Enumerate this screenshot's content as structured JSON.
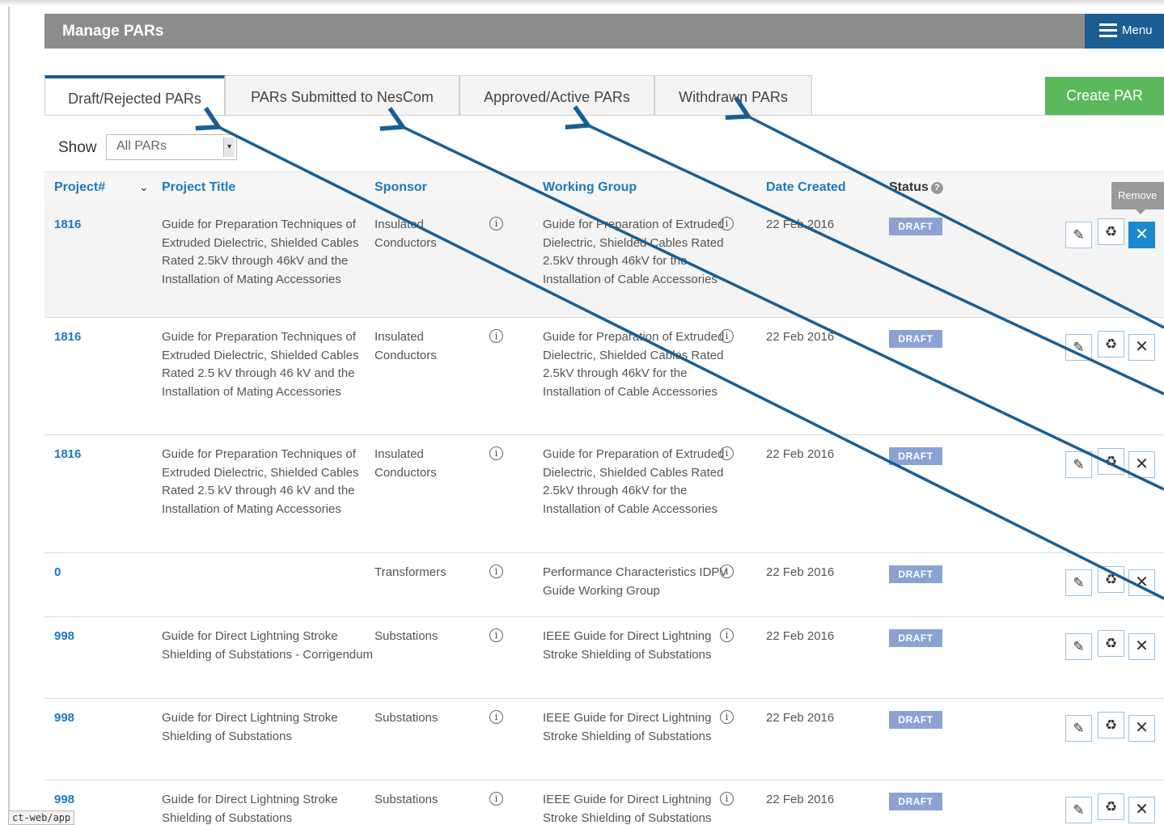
{
  "header": {
    "title": "Manage PARs",
    "menu_label": "Menu"
  },
  "tabs": [
    {
      "label": "Draft/Rejected PARs",
      "active": true
    },
    {
      "label": "PARs Submitted to NesCom",
      "active": false
    },
    {
      "label": "Approved/Active PARs",
      "active": false
    },
    {
      "label": "Withdrawn PARs",
      "active": false
    }
  ],
  "create_button": "Create PAR",
  "filter": {
    "label": "Show",
    "selected": "All PARs"
  },
  "columns": {
    "project": "Project#",
    "title": "Project Title",
    "sponsor": "Sponsor",
    "wg": "Working Group",
    "date": "Date Created",
    "status": "Status"
  },
  "tooltip": "Remove",
  "rows": [
    {
      "num": "1816",
      "title": "Guide for Preparation Techniques of Extruded Dielectric, Shielded Cables Rated 2.5kV through 46kV and the Installation of Mating Accessories",
      "sponsor": "Insulated Conductors",
      "wg": "Guide for Preparation of Extruded Dielectric, Shielded Cables Rated 2.5kV through 46kV for the Installation of Cable Accessories",
      "date": "22 Feb 2016",
      "status": "DRAFT"
    },
    {
      "num": "1816",
      "title": "Guide for Preparation Techniques of Extruded Dielectric, Shielded Cables Rated 2.5 kV through 46 kV and the Installation of Mating Accessories",
      "sponsor": "Insulated Conductors",
      "wg": "Guide for Preparation of Extruded Dielectric, Shielded Cables Rated 2.5kV through 46kV for the Installation of Cable Accessories",
      "date": "22 Feb 2016",
      "status": "DRAFT"
    },
    {
      "num": "1816",
      "title": "Guide for Preparation Techniques of Extruded Dielectric, Shielded Cables Rated 2.5 kV through 46 kV and the Installation of Mating Accessories",
      "sponsor": "Insulated Conductors",
      "wg": "Guide for Preparation of Extruded Dielectric, Shielded Cables Rated 2.5kV through 46kV for the Installation of Cable Accessories",
      "date": "22 Feb 2016",
      "status": "DRAFT"
    },
    {
      "num": "0",
      "title": "",
      "sponsor": "Transformers",
      "wg": "Performance Characteristics IDPV Guide Working Group",
      "date": "22 Feb 2016",
      "status": "DRAFT"
    },
    {
      "num": "998",
      "title": "Guide for Direct Lightning Stroke Shielding of Substations - Corrigendum",
      "sponsor": "Substations",
      "wg": "IEEE Guide for Direct Lightning Stroke Shielding of Substations",
      "date": "22 Feb 2016",
      "status": "DRAFT"
    },
    {
      "num": "998",
      "title": "Guide for Direct Lightning Stroke Shielding of Substations",
      "sponsor": "Substations",
      "wg": "IEEE Guide for Direct Lightning Stroke Shielding of Substations",
      "date": "22 Feb 2016",
      "status": "DRAFT"
    },
    {
      "num": "998",
      "title": "Guide for Direct Lightning Stroke Shielding of Substations",
      "sponsor": "Substations",
      "wg": "IEEE Guide for Direct Lightning Stroke Shielding of Substations",
      "date": "22 Feb 2016",
      "status": "DRAFT"
    }
  ],
  "icons": {
    "edit": "pencil-icon",
    "clone": "recycle-icon",
    "remove": "close-icon",
    "info": "info-icon",
    "help": "question-circle-icon",
    "menu": "hamburger-icon"
  },
  "colors": {
    "accent": "#1a5e93",
    "link": "#1e78c2",
    "badge": "#8aa3d2",
    "create": "#5cb85c",
    "annotation": "#1a5e93"
  },
  "status_url": "ct-web/app"
}
